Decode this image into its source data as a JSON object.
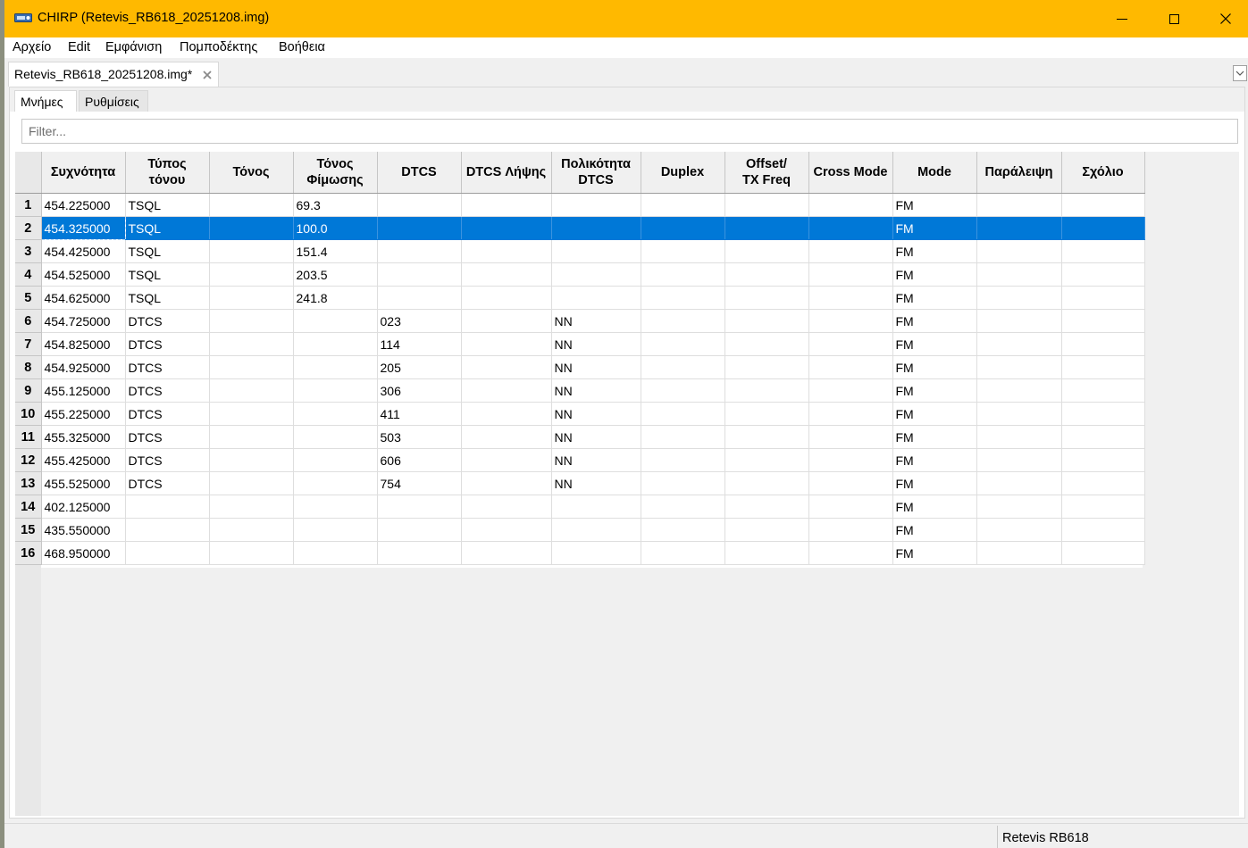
{
  "window": {
    "title": "CHIRP (Retevis_RB618_20251208.img)",
    "accent_color": "#ffb900",
    "controls": [
      "minimize-icon",
      "maximize-icon",
      "close-icon"
    ]
  },
  "menu": {
    "items": [
      "Αρχείο",
      "Edit",
      "Εμφάνιση",
      "Πομποδέκτης",
      "Βοήθεια"
    ]
  },
  "document_tab": {
    "label": "Retevis_RB618_20251208.img*",
    "close_icon": "close-icon"
  },
  "inner_tabs": [
    "Μνήμες",
    "Ρυθμίσεις"
  ],
  "inner_tabs_active": "Μνήμες",
  "filter": {
    "placeholder": "Filter...",
    "value": ""
  },
  "table": {
    "columns": [
      "Συχνότητα",
      "Τύπος\nτόνου",
      "Τόνος",
      "Τόνος\nΦίμωσης",
      "DTCS",
      "DTCS Λήψης",
      "Πολικότητα\nDTCS",
      "Duplex",
      "Offset/\nTX Freq",
      "Cross Mode",
      "Mode",
      "Παράλειψη",
      "Σχόλιο"
    ],
    "selected_row": 2,
    "selection_color": "#0078d7",
    "rows": [
      {
        "num": "1",
        "cells": [
          "454.225000",
          "TSQL",
          "",
          "69.3",
          "",
          "",
          "",
          "",
          "",
          "",
          "FM",
          "",
          ""
        ]
      },
      {
        "num": "2",
        "cells": [
          "454.325000",
          "TSQL",
          "",
          "100.0",
          "",
          "",
          "",
          "",
          "",
          "",
          "FM",
          "",
          ""
        ]
      },
      {
        "num": "3",
        "cells": [
          "454.425000",
          "TSQL",
          "",
          "151.4",
          "",
          "",
          "",
          "",
          "",
          "",
          "FM",
          "",
          ""
        ]
      },
      {
        "num": "4",
        "cells": [
          "454.525000",
          "TSQL",
          "",
          "203.5",
          "",
          "",
          "",
          "",
          "",
          "",
          "FM",
          "",
          ""
        ]
      },
      {
        "num": "5",
        "cells": [
          "454.625000",
          "TSQL",
          "",
          "241.8",
          "",
          "",
          "",
          "",
          "",
          "",
          "FM",
          "",
          ""
        ]
      },
      {
        "num": "6",
        "cells": [
          "454.725000",
          "DTCS",
          "",
          "",
          "023",
          "",
          "NN",
          "",
          "",
          "",
          "FM",
          "",
          ""
        ]
      },
      {
        "num": "7",
        "cells": [
          "454.825000",
          "DTCS",
          "",
          "",
          "114",
          "",
          "NN",
          "",
          "",
          "",
          "FM",
          "",
          ""
        ]
      },
      {
        "num": "8",
        "cells": [
          "454.925000",
          "DTCS",
          "",
          "",
          "205",
          "",
          "NN",
          "",
          "",
          "",
          "FM",
          "",
          ""
        ]
      },
      {
        "num": "9",
        "cells": [
          "455.125000",
          "DTCS",
          "",
          "",
          "306",
          "",
          "NN",
          "",
          "",
          "",
          "FM",
          "",
          ""
        ]
      },
      {
        "num": "10",
        "cells": [
          "455.225000",
          "DTCS",
          "",
          "",
          "411",
          "",
          "NN",
          "",
          "",
          "",
          "FM",
          "",
          ""
        ]
      },
      {
        "num": "11",
        "cells": [
          "455.325000",
          "DTCS",
          "",
          "",
          "503",
          "",
          "NN",
          "",
          "",
          "",
          "FM",
          "",
          ""
        ]
      },
      {
        "num": "12",
        "cells": [
          "455.425000",
          "DTCS",
          "",
          "",
          "606",
          "",
          "NN",
          "",
          "",
          "",
          "FM",
          "",
          ""
        ]
      },
      {
        "num": "13",
        "cells": [
          "455.525000",
          "DTCS",
          "",
          "",
          "754",
          "",
          "NN",
          "",
          "",
          "",
          "FM",
          "",
          ""
        ]
      },
      {
        "num": "14",
        "cells": [
          "402.125000",
          "",
          "",
          "",
          "",
          "",
          "",
          "",
          "",
          "",
          "FM",
          "",
          ""
        ]
      },
      {
        "num": "15",
        "cells": [
          "435.550000",
          "",
          "",
          "",
          "",
          "",
          "",
          "",
          "",
          "",
          "FM",
          "",
          ""
        ]
      },
      {
        "num": "16",
        "cells": [
          "468.950000",
          "",
          "",
          "",
          "",
          "",
          "",
          "",
          "",
          "",
          "FM",
          "",
          ""
        ]
      }
    ]
  },
  "status": {
    "radio_model": "Retevis RB618"
  }
}
